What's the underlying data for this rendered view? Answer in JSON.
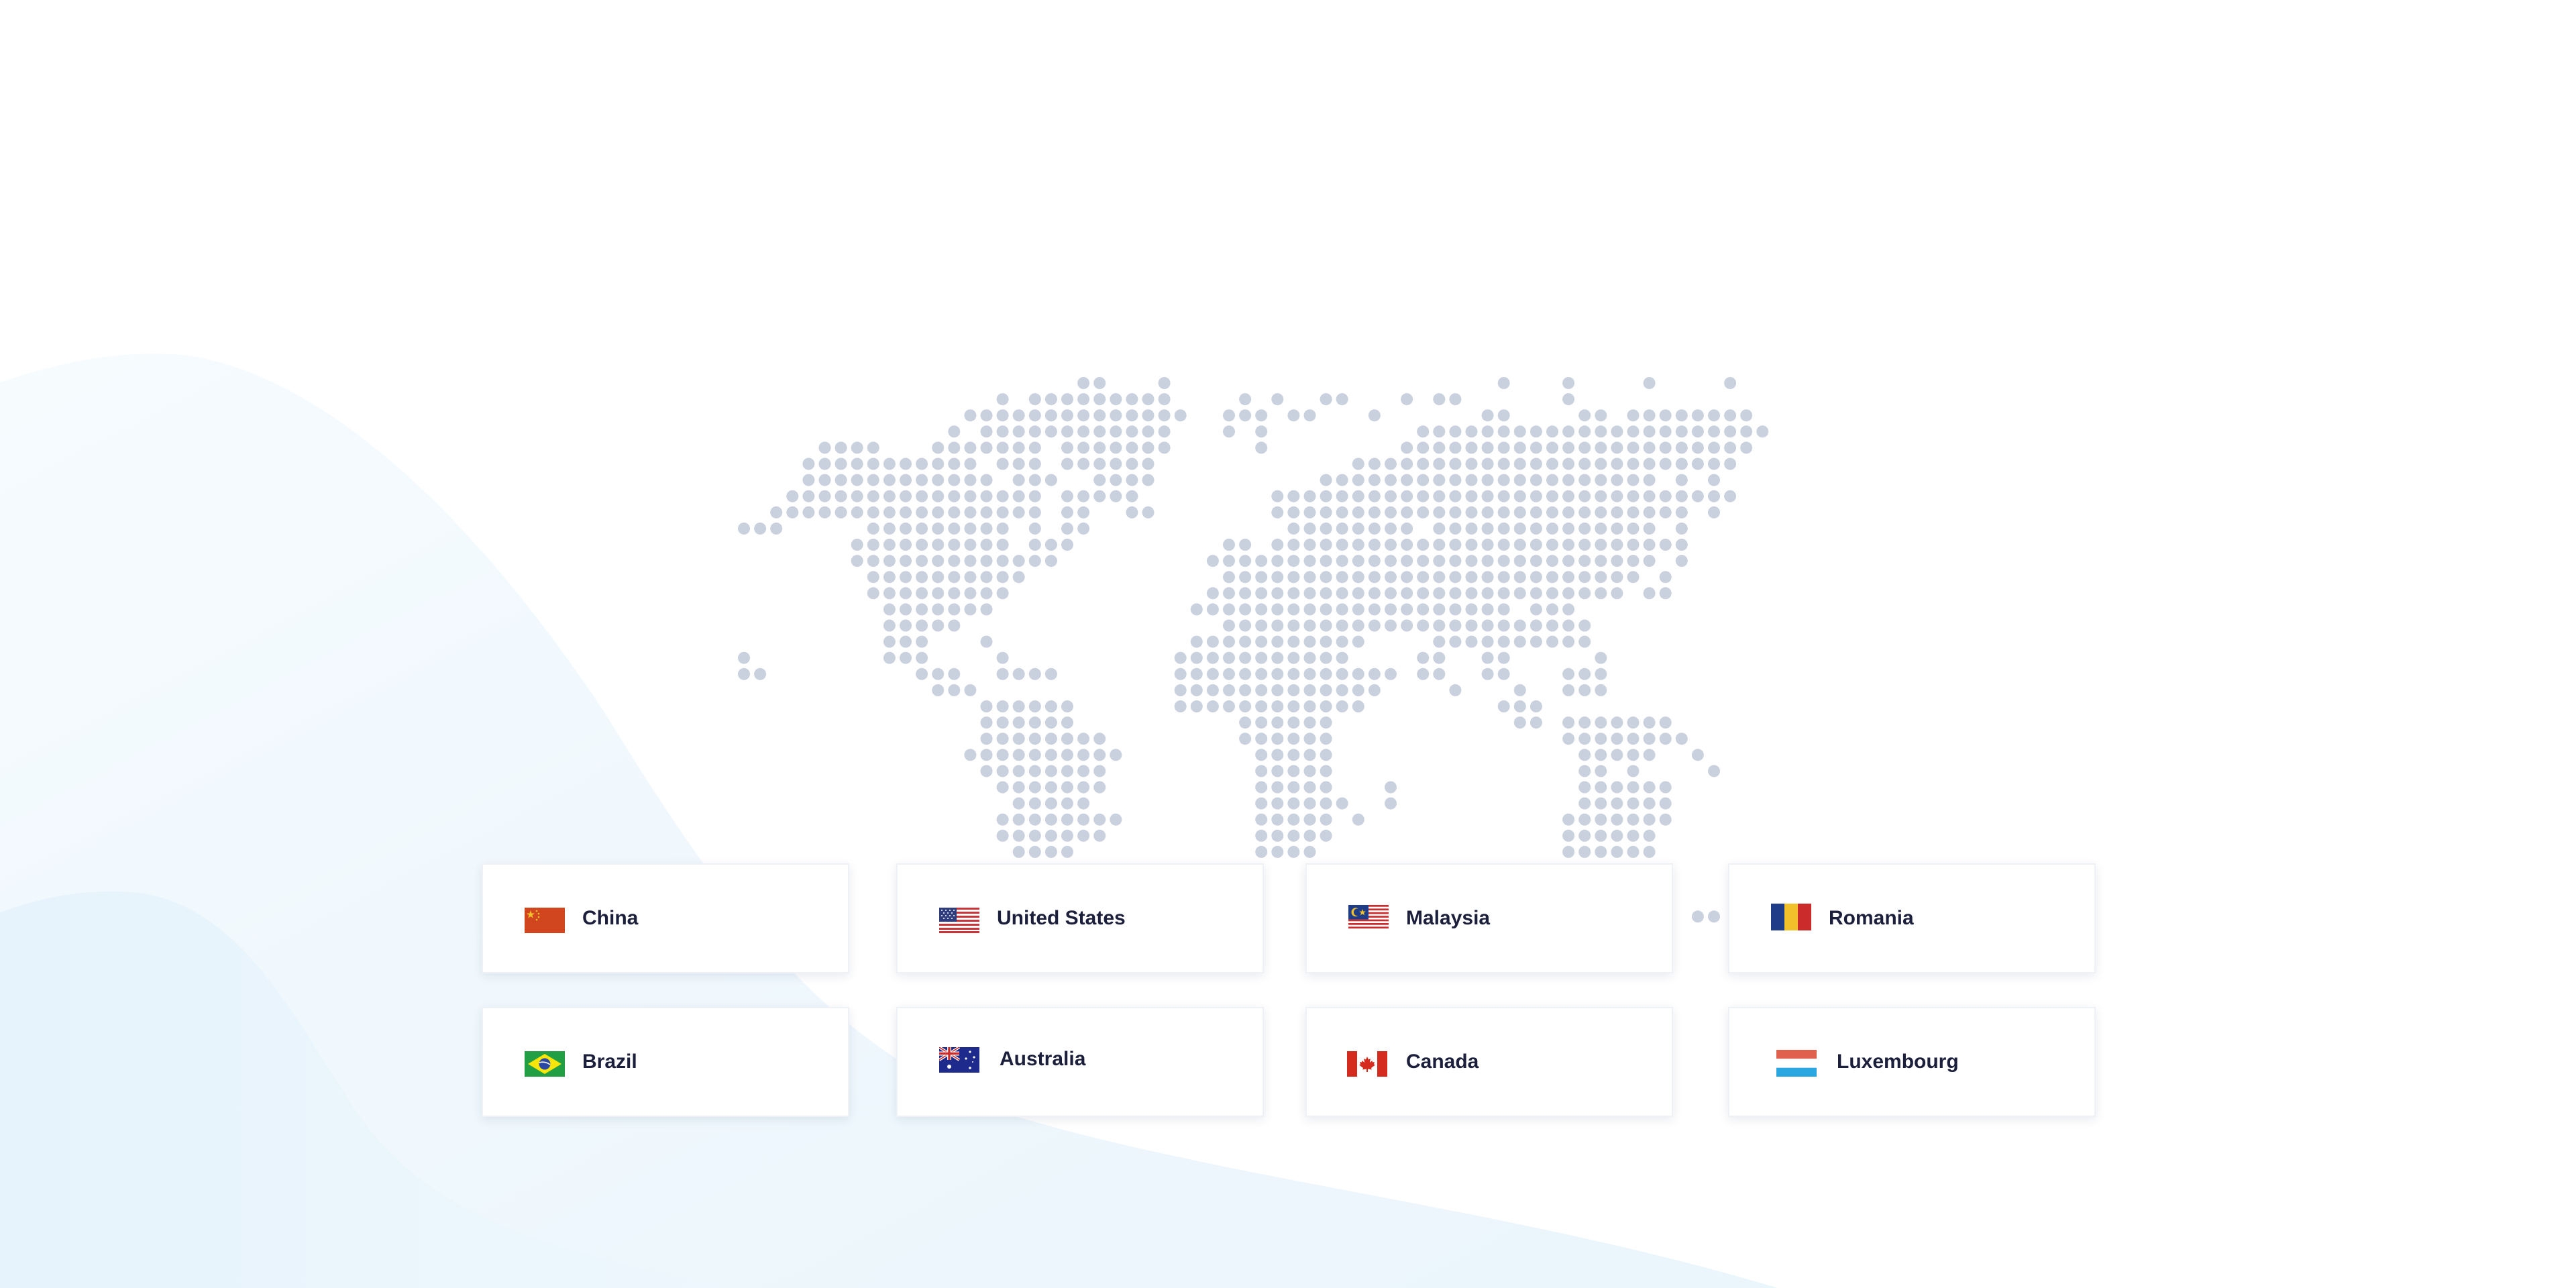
{
  "countries": [
    {
      "name": "China",
      "flag": "china-flag-icon"
    },
    {
      "name": "United States",
      "flag": "us-flag-icon"
    },
    {
      "name": "Malaysia",
      "flag": "malaysia-flag-icon"
    },
    {
      "name": "Romania",
      "flag": "romania-flag-icon"
    },
    {
      "name": "Brazil",
      "flag": "brazil-flag-icon"
    },
    {
      "name": "Australia",
      "flag": "australia-flag-icon"
    },
    {
      "name": "Canada",
      "flag": "canada-flag-icon"
    },
    {
      "name": "Luxembourg",
      "flag": "luxembourg-flag-icon"
    }
  ],
  "colors": {
    "map_dot": "#c9d0de",
    "card_text": "#1b1f3b",
    "wave_light": "#eef7fd",
    "wave_mid": "#e3f2fc"
  }
}
